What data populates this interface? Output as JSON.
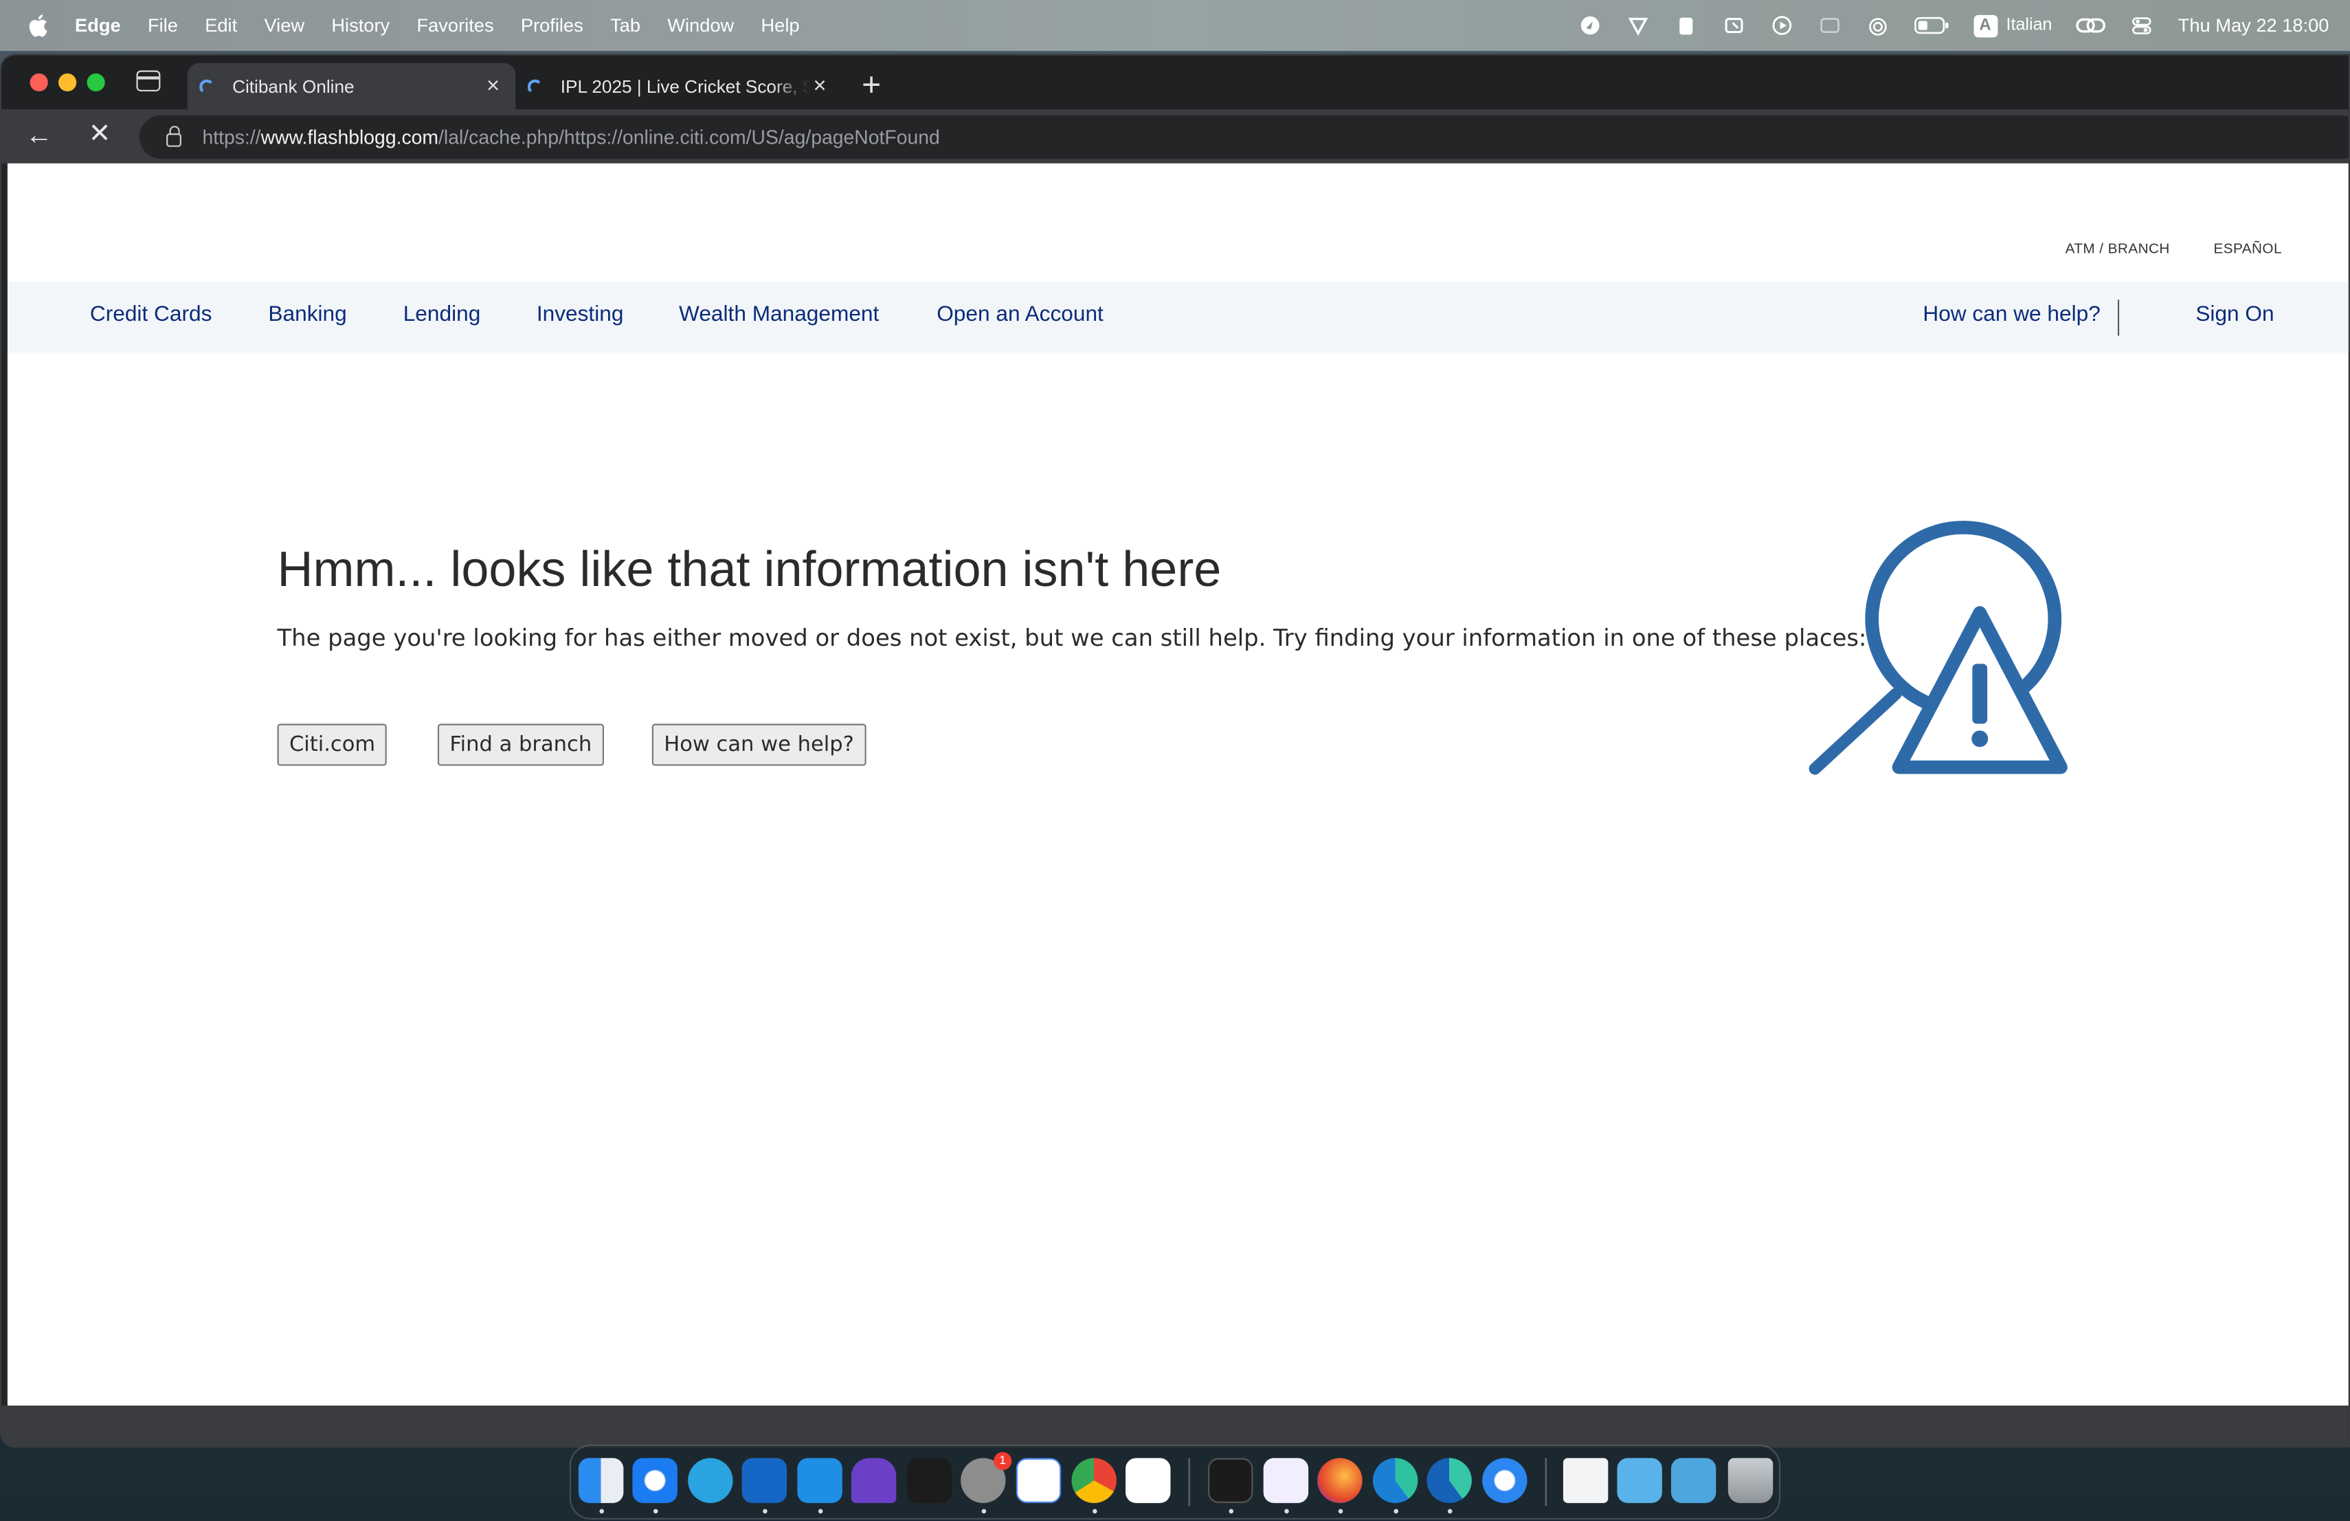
{
  "menubar": {
    "app_name": "Edge",
    "items": [
      "File",
      "Edit",
      "View",
      "History",
      "Favorites",
      "Profiles",
      "Tab",
      "Window",
      "Help"
    ],
    "input_badge": "A",
    "input_language": "Italian",
    "datetime": "Thu May 22  18:00"
  },
  "browser": {
    "tabs": [
      {
        "title": "Citibank Online",
        "active": true,
        "close": "×"
      },
      {
        "title": "IPL 2025 | Live Cricket Score, S",
        "active": false,
        "close": "×"
      }
    ],
    "new_tab": "+",
    "back": "←",
    "stop": "✕",
    "url": {
      "scheme": "https://",
      "host": "www.flashblogg.com",
      "path": "/lal/cache.php/https://online.citi.com/US/ag/pageNotFound"
    }
  },
  "page": {
    "utility_links": {
      "atm": "ATM / BRANCH",
      "espanol": "ESPAÑOL"
    },
    "nav": {
      "credit_cards": "Credit Cards",
      "banking": "Banking",
      "lending": "Lending",
      "investing": "Investing",
      "wealth": "Wealth Management",
      "open_account": "Open an Account",
      "help": "How can we help?",
      "sign_on": "Sign On"
    },
    "error": {
      "title": "Hmm... looks like that information isn't here",
      "description": "The page you're looking for has either moved or does not exist, but we can still help. Try finding your information in one of these places:",
      "buttons": {
        "citi": "Citi.com",
        "branch": "Find a branch",
        "help": "How can we help?"
      }
    },
    "colors": {
      "nav_link": "#0b2c7a",
      "illustration": "#2f6aa8",
      "nav_bg": "#f3f6f9"
    }
  },
  "dock": {
    "settings_badge": "1",
    "apps": [
      "finder-icon",
      "safari-icon",
      "telegram-icon",
      "outlook-icon",
      "vscode-icon",
      "obsidian-icon",
      "figma-icon",
      "system-settings-icon",
      "docs-icon",
      "chrome-icon",
      "moodle-icon",
      "activity-monitor-icon",
      "proton-vpn-icon",
      "firefox-icon",
      "edge-icon",
      "edge-beta-icon",
      "safari-alt-icon",
      "file-icon",
      "folder-icon",
      "downloads-folder-icon",
      "trash-icon"
    ]
  }
}
